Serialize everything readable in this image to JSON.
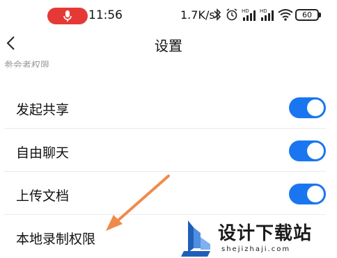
{
  "status_bar": {
    "time": "11:56",
    "network_speed": "1.7K/s",
    "battery": "60",
    "signal_label_1": "HD",
    "signal_label_2": "HD"
  },
  "header": {
    "title": "设置"
  },
  "section": {
    "label": "参会者权限"
  },
  "rows": [
    {
      "label": "发起共享",
      "toggle_on": true
    },
    {
      "label": "自由聊天",
      "toggle_on": true
    },
    {
      "label": "上传文档",
      "toggle_on": true
    },
    {
      "label": "本地录制权限"
    }
  ],
  "watermark": {
    "text": "设计下载站",
    "url": "shejizhaji.com"
  },
  "colors": {
    "accent": "#1976f0",
    "recording": "#e53935",
    "arrow": "#f08a4b"
  }
}
